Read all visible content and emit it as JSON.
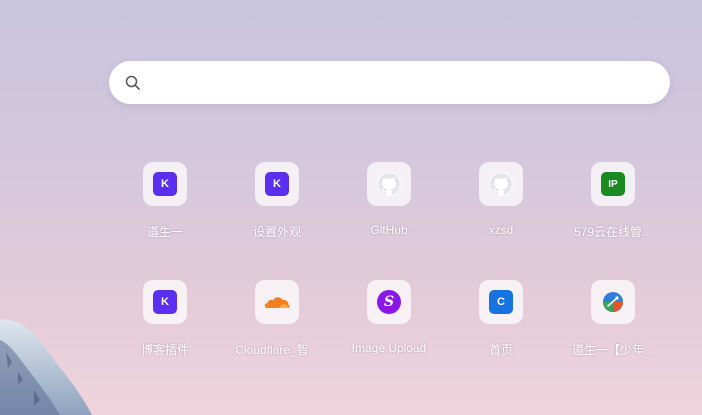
{
  "search": {
    "placeholder": ""
  },
  "shortcuts": [
    {
      "label": "道生一",
      "icon": "k-logo-icon",
      "badge": "K",
      "color": "#5b2ff0"
    },
    {
      "label": "设置外观",
      "icon": "k-logo-icon",
      "badge": "K",
      "color": "#5b2ff0"
    },
    {
      "label": "GitHub",
      "icon": "github-icon",
      "badge": "",
      "color": "#ffffff"
    },
    {
      "label": "xzsd",
      "icon": "github-icon",
      "badge": "",
      "color": "#ffffff"
    },
    {
      "label": "579云在线管...",
      "icon": "ip-logo-icon",
      "badge": "IP",
      "color": "#1c8a23"
    },
    {
      "label": "博客插件",
      "icon": "k-logo-icon",
      "badge": "K",
      "color": "#5b2ff0"
    },
    {
      "label": "Cloudflare_智...",
      "icon": "cloudflare-icon",
      "badge": "",
      "color": "#f38020"
    },
    {
      "label": "Image Upload",
      "icon": "image-upload-icon",
      "badge": "S",
      "color": "#8a16e8"
    },
    {
      "label": "首页",
      "icon": "c-logo-icon",
      "badge": "C",
      "color": "#1773e0"
    },
    {
      "label": "道生一【少年...",
      "icon": "compass-icon",
      "badge": "",
      "color": "#3a7bd5"
    }
  ]
}
